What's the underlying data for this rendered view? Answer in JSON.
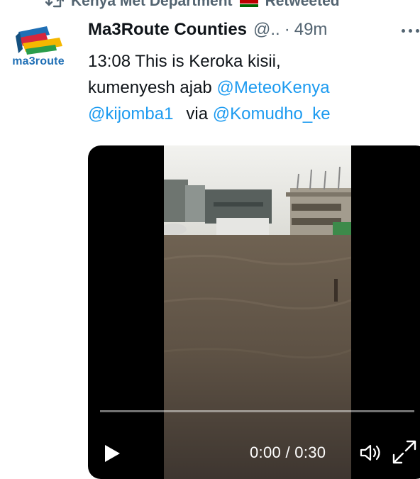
{
  "retweet": {
    "account": "Kenya Met Department",
    "label": "Retweeted",
    "icon": "retweet-icon",
    "flag_colors": [
      "#000000",
      "#bb0000",
      "#006600"
    ]
  },
  "tweet": {
    "author_name": "Ma3Route Counties",
    "handle": "@..",
    "separator": "·",
    "time_ago": "49m",
    "avatar_text": "ma3route",
    "text_parts": {
      "line1": "13:08 This is Keroka kisii,",
      "line2_plain": "kumenyesh ajab ",
      "mention1": "@MeteoKenya",
      "mention2": "@kijomba1",
      "via": "via",
      "mention3": "@Komudho_ke"
    }
  },
  "video": {
    "current_time": "0:00",
    "separator": "/",
    "duration": "0:30",
    "progress": 0,
    "play_icon": "play-icon",
    "volume_icon": "volume-icon",
    "fullscreen_icon": "fullscreen-icon"
  },
  "colors": {
    "link": "#1d9bf0",
    "secondary_text": "#536471",
    "primary_text": "#0f1419"
  }
}
